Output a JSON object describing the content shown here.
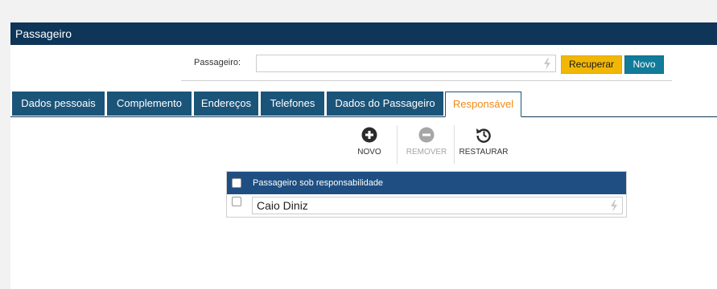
{
  "window": {
    "title": "Passageiro"
  },
  "search": {
    "label": "Passageiro:",
    "value": "",
    "recuperar_label": "Recuperar",
    "novo_label": "Novo"
  },
  "tabs": [
    {
      "label": "Dados pessoais"
    },
    {
      "label": "Complemento"
    },
    {
      "label": "Endereços"
    },
    {
      "label": "Telefones"
    },
    {
      "label": "Dados do Passageiro"
    },
    {
      "label": "Responsável",
      "active": true
    }
  ],
  "toolbar": {
    "novo": "NOVO",
    "remover": "REMOVER",
    "restaurar": "RESTAURAR"
  },
  "grid": {
    "header": "Passageiro sob responsabilidade",
    "rows": [
      {
        "value": "Caio Diniz"
      }
    ]
  },
  "colors": {
    "title_bar": "#0f3558",
    "tab_bg": "#1b5479",
    "active_tab_text": "#f08a14",
    "recuperar_btn": "#f2b705",
    "novo_btn": "#127b9a",
    "grid_header": "#1f4f82"
  }
}
